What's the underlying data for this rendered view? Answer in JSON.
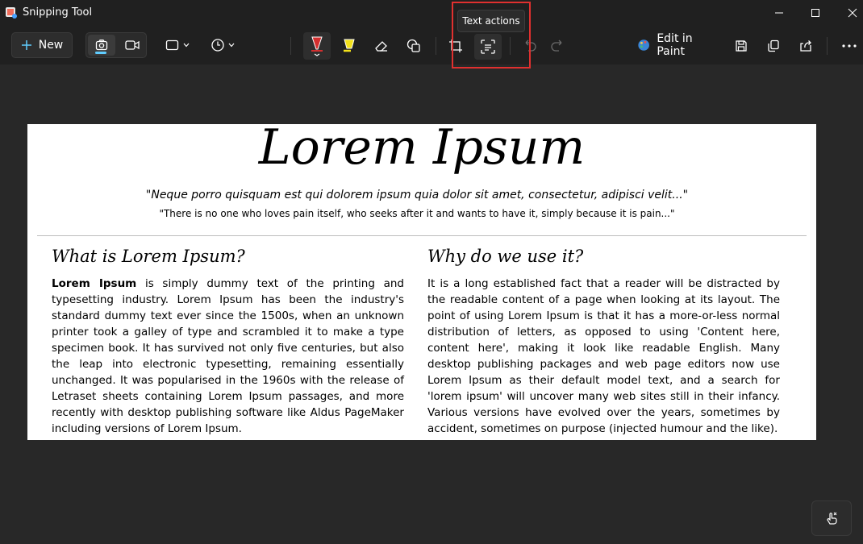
{
  "window": {
    "title": "Snipping Tool"
  },
  "toolbar": {
    "new_label": "New",
    "edit_in_paint_label": "Edit in Paint",
    "tooltip": "Text actions"
  },
  "document": {
    "title": "Lorem Ipsum",
    "quote_latin": "\"Neque porro quisquam est qui dolorem ipsum quia dolor sit amet, consectetur, adipisci velit...\"",
    "quote_english": "\"There is no one who loves pain itself, who seeks after it and wants to have it, simply because it is pain...\"",
    "left_heading": "What is Lorem Ipsum?",
    "left_bold": "Lorem Ipsum",
    "left_body": " is simply dummy text of the printing and typesetting industry. Lorem Ipsum has been the industry's standard dummy text ever since the 1500s, when an unknown printer took a galley of type and scrambled it to make a type specimen book. It has survived not only five centuries, but also the leap into electronic typesetting, remaining essentially unchanged. It was popularised in the 1960s with the release of Letraset sheets containing Lorem Ipsum passages, and more recently with desktop publishing software like Aldus PageMaker including versions of Lorem Ipsum.",
    "right_heading": "Why do we use it?",
    "right_body": "It is a long established fact that a reader will be distracted by the readable content of a page when looking at its layout. The point of using Lorem Ipsum is that it has a more-or-less normal distribution of letters, as opposed to using 'Content here, content here', making it look like readable English. Many desktop publishing packages and web page editors now use Lorem Ipsum as their default model text, and a search for 'lorem ipsum' will uncover many web sites still in their infancy. Various versions have evolved over the years, sometimes by accident, sometimes on purpose (injected humour and the like)."
  },
  "colors": {
    "accent": "#60cdff",
    "highlight_border": "#e0302f",
    "background": "#282828",
    "titlebar": "#202020"
  }
}
